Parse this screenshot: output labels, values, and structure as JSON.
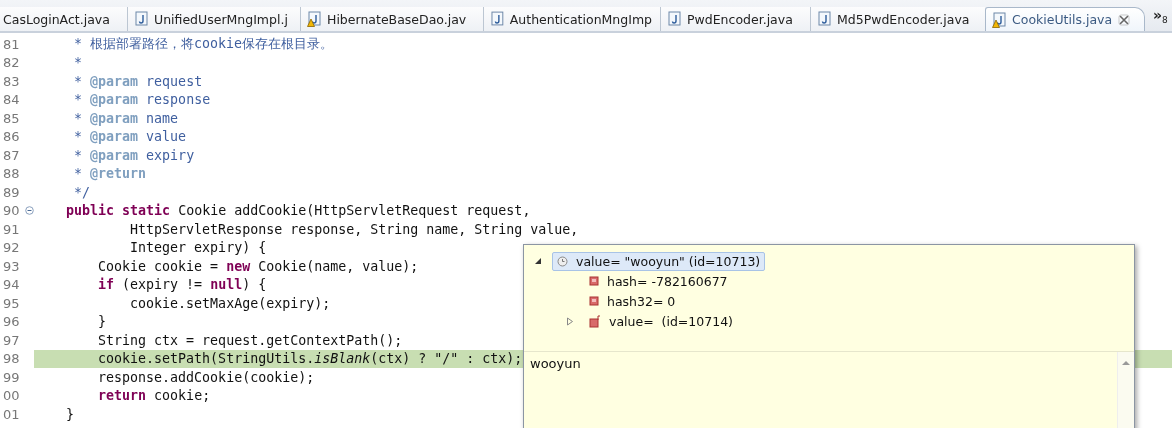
{
  "tabs": [
    {
      "label": "CasLoginAct.java",
      "kind": "cut",
      "warning": false,
      "selected": false
    },
    {
      "label": "UnifiedUserMngImpl.j",
      "kind": "java",
      "warning": false,
      "selected": false
    },
    {
      "label": "HibernateBaseDao.jav",
      "kind": "java",
      "warning": true,
      "selected": false
    },
    {
      "label": "AuthenticationMngImp",
      "kind": "java",
      "warning": false,
      "selected": false
    },
    {
      "label": "PwdEncoder.java",
      "kind": "java",
      "warning": false,
      "selected": false
    },
    {
      "label": "Md5PwdEncoder.java",
      "kind": "java",
      "warning": false,
      "selected": false
    },
    {
      "label": "CookieUtils.java",
      "kind": "java",
      "warning": true,
      "selected": true
    }
  ],
  "tab_overflow": {
    "chevron": "»",
    "count": "8"
  },
  "lines": [
    {
      "num": "81",
      "kind": "doc",
      "fold_marker": false,
      "current": false,
      "text": "     * 根据部署路径，将cookie保存在根目录。"
    },
    {
      "num": "82",
      "kind": "doc",
      "fold_marker": false,
      "current": false,
      "text": "     *"
    },
    {
      "num": "83",
      "kind": "doc",
      "fold_marker": false,
      "current": false,
      "text": "     * **@param** request"
    },
    {
      "num": "84",
      "kind": "doc",
      "fold_marker": false,
      "current": false,
      "text": "     * **@param** response"
    },
    {
      "num": "85",
      "kind": "doc",
      "fold_marker": false,
      "current": false,
      "text": "     * **@param** name"
    },
    {
      "num": "86",
      "kind": "doc",
      "fold_marker": false,
      "current": false,
      "text": "     * **@param** value"
    },
    {
      "num": "87",
      "kind": "doc",
      "fold_marker": false,
      "current": false,
      "text": "     * **@param** expiry"
    },
    {
      "num": "88",
      "kind": "doc",
      "fold_marker": false,
      "current": false,
      "text": "     * **@return**"
    },
    {
      "num": "89",
      "kind": "doc",
      "fold_marker": false,
      "current": false,
      "text": "     */"
    },
    {
      "num": "90",
      "kind": "code",
      "fold_marker": true,
      "current": false,
      "text": "    **public** **static** Cookie addCookie(HttpServletRequest request,"
    },
    {
      "num": "91",
      "kind": "code",
      "fold_marker": false,
      "current": false,
      "text": "            HttpServletResponse response, String name, String value,"
    },
    {
      "num": "92",
      "kind": "code",
      "fold_marker": false,
      "current": false,
      "text": "            Integer expiry) {"
    },
    {
      "num": "93",
      "kind": "code",
      "fold_marker": false,
      "current": false,
      "text": "        Cookie cookie = **new** Cookie(name, value);"
    },
    {
      "num": "94",
      "kind": "code",
      "fold_marker": false,
      "current": false,
      "text": "        **if** (expiry != **null**) {"
    },
    {
      "num": "95",
      "kind": "code",
      "fold_marker": false,
      "current": false,
      "text": "            cookie.setMaxAge(expiry);"
    },
    {
      "num": "96",
      "kind": "code",
      "fold_marker": false,
      "current": false,
      "text": "        }"
    },
    {
      "num": "97",
      "kind": "code",
      "fold_marker": false,
      "current": false,
      "text": "        String ctx = request.getContextPath();"
    },
    {
      "num": "98",
      "kind": "code",
      "fold_marker": false,
      "current": true,
      "text": "        cookie.setPath(StringUtils.*isBlank*(ctx) ? \"/\" : ctx);"
    },
    {
      "num": "99",
      "kind": "code",
      "fold_marker": false,
      "current": false,
      "text": "        response.addCookie(cookie);"
    },
    {
      "num": "00",
      "kind": "code",
      "fold_marker": false,
      "current": false,
      "text": "        **return** cookie;"
    },
    {
      "num": "01",
      "kind": "code",
      "fold_marker": false,
      "current": false,
      "text": "    }"
    }
  ],
  "inspect_popup": {
    "tree": [
      {
        "label": "value= \"wooyun\" (id=10713)",
        "kind": "variable",
        "expanded": true,
        "selected": true,
        "children": [
          {
            "label": "hash= -782160677",
            "kind": "field",
            "selected": false
          },
          {
            "label": "hash32= 0",
            "kind": "field",
            "selected": false
          },
          {
            "label": "value=  (id=10714)",
            "kind": "final-field",
            "expanded": false,
            "selected": false
          }
        ]
      }
    ],
    "detail": "wooyun"
  }
}
